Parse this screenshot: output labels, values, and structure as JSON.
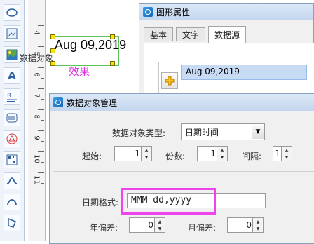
{
  "toolbar": {
    "tools": [
      {
        "icon": "ellipse-icon"
      },
      {
        "icon": "image-frame-icon"
      },
      {
        "icon": "picture-icon"
      },
      {
        "icon": "text-icon",
        "glyph": "A"
      },
      {
        "icon": "rich-text-icon"
      },
      {
        "icon": "barcode-icon"
      },
      {
        "icon": "stamp-icon"
      },
      {
        "icon": "qrcode-icon"
      },
      {
        "icon": "curve-icon"
      },
      {
        "icon": "arc-icon"
      },
      {
        "icon": "polygon-icon"
      }
    ]
  },
  "ruler": {
    "labels": [
      "4",
      "5",
      "6",
      "7",
      "8",
      "9",
      "10",
      "11"
    ]
  },
  "canvas": {
    "date_text": "Aug 09,2019",
    "effect_text": "效果"
  },
  "props_dialog": {
    "title": "图形属性",
    "tabs": [
      "基本",
      "文字",
      "数据源"
    ],
    "active_tab": "数据源",
    "data_object_label": "数据对象",
    "add_icon": "add-icon",
    "data_object_item": "Aug 09,2019"
  },
  "mgr_dialog": {
    "title": "数据对象管理",
    "type_label": "数据对象类型:",
    "type_value": "日期时间",
    "start_label": "起始:",
    "start_value": "1",
    "copies_label": "份数:",
    "copies_value": "1",
    "interval_label": "间隔:",
    "interval_value": "1",
    "format_label": "日期格式:",
    "format_value": "MMM dd,yyyy",
    "year_offset_label": "年偏差:",
    "year_offset_value": "0",
    "month_offset_label": "月偏差:",
    "month_offset_value": "0"
  },
  "colors": {
    "highlight": "#ee44ee",
    "effect_text": "#e02ee0",
    "selection": "#5ec25e",
    "handle": "#f6e400"
  }
}
